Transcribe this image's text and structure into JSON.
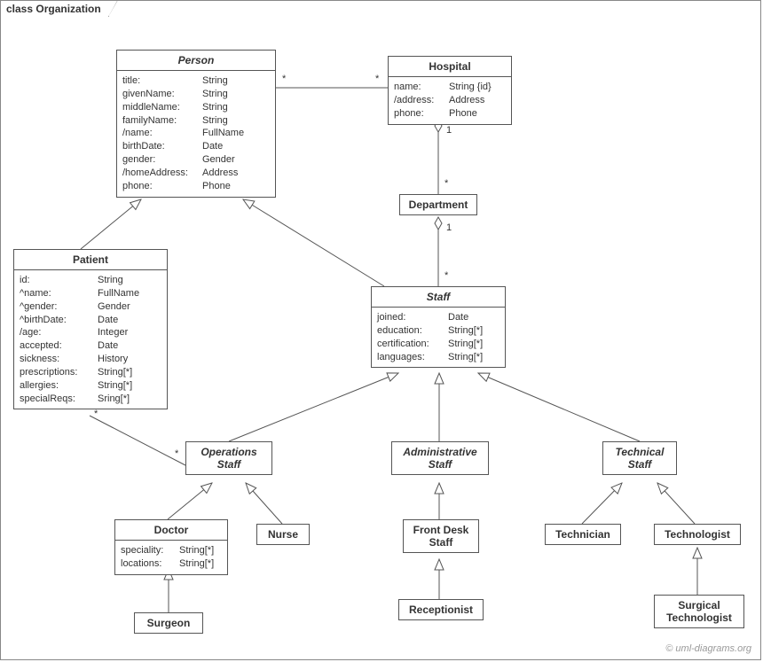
{
  "frame": {
    "title": "class Organization"
  },
  "watermark": "© uml-diagrams.org",
  "classes": {
    "person": {
      "title": "Person",
      "attrs": [
        {
          "name": "title:",
          "type": "String"
        },
        {
          "name": "givenName:",
          "type": "String"
        },
        {
          "name": "middleName:",
          "type": "String"
        },
        {
          "name": "familyName:",
          "type": "String"
        },
        {
          "name": "/name:",
          "type": "FullName"
        },
        {
          "name": "birthDate:",
          "type": "Date"
        },
        {
          "name": "gender:",
          "type": "Gender"
        },
        {
          "name": "/homeAddress:",
          "type": "Address"
        },
        {
          "name": "phone:",
          "type": "Phone"
        }
      ]
    },
    "hospital": {
      "title": "Hospital",
      "attrs": [
        {
          "name": "name:",
          "type": "String {id}"
        },
        {
          "name": "/address:",
          "type": "Address"
        },
        {
          "name": "phone:",
          "type": "Phone"
        }
      ]
    },
    "department": {
      "title": "Department"
    },
    "patient": {
      "title": "Patient",
      "attrs": [
        {
          "name": "id:",
          "type": "String"
        },
        {
          "name": "^name:",
          "type": "FullName"
        },
        {
          "name": "^gender:",
          "type": "Gender"
        },
        {
          "name": "^birthDate:",
          "type": "Date"
        },
        {
          "name": "/age:",
          "type": "Integer"
        },
        {
          "name": "accepted:",
          "type": "Date"
        },
        {
          "name": "sickness:",
          "type": "History"
        },
        {
          "name": "prescriptions:",
          "type": "String[*]"
        },
        {
          "name": "allergies:",
          "type": "String[*]"
        },
        {
          "name": "specialReqs:",
          "type": "Sring[*]"
        }
      ]
    },
    "staff": {
      "title": "Staff",
      "attrs": [
        {
          "name": "joined:",
          "type": "Date"
        },
        {
          "name": "education:",
          "type": "String[*]"
        },
        {
          "name": "certification:",
          "type": "String[*]"
        },
        {
          "name": "languages:",
          "type": "String[*]"
        }
      ]
    },
    "operationsStaff": {
      "title": "Operations Staff"
    },
    "administrativeStaff": {
      "title": "Administrative Staff"
    },
    "technicalStaff": {
      "title": "Technical Staff"
    },
    "doctor": {
      "title": "Doctor",
      "attrs": [
        {
          "name": "speciality:",
          "type": "String[*]"
        },
        {
          "name": "locations:",
          "type": "String[*]"
        }
      ]
    },
    "nurse": {
      "title": "Nurse"
    },
    "frontDeskStaff": {
      "title": "Front Desk Staff"
    },
    "receptionist": {
      "title": "Receptionist"
    },
    "technician": {
      "title": "Technician"
    },
    "technologist": {
      "title": "Technologist"
    },
    "surgicalTechnologist": {
      "title": "Surgical Technologist"
    },
    "surgeon": {
      "title": "Surgeon"
    }
  },
  "multiplicities": {
    "personHospital_person": "*",
    "personHospital_hospital": "*",
    "hospitalDept_hospital": "1",
    "hospitalDept_dept": "*",
    "deptStaff_dept": "1",
    "deptStaff_staff": "*",
    "patientOps_patient": "*",
    "patientOps_ops": "*"
  }
}
